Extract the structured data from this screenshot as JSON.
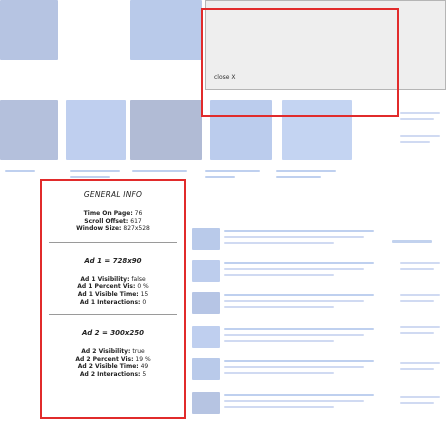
{
  "ad_popup": {
    "close_label": "close X"
  },
  "general_info": {
    "title": "GENERAL INFO",
    "time_on_page": {
      "label": "Time On Page:",
      "value": "76"
    },
    "scroll_offset": {
      "label": "Scroll Offset:",
      "value": "617"
    },
    "window_size": {
      "label": "Window Size:",
      "value": "827x528"
    }
  },
  "ads": [
    {
      "title": "Ad 1 = 728x90",
      "visibility": {
        "label": "Ad 1 Visibility:",
        "value": "false"
      },
      "percent_vis": {
        "label": "Ad 1 Percent Vis:",
        "value": "0 %"
      },
      "visible_time": {
        "label": "Ad 1 Visible Time:",
        "value": "15"
      },
      "interactions": {
        "label": "Ad 1 Interactions:",
        "value": "0"
      }
    },
    {
      "title": "Ad 2 = 300x250",
      "visibility": {
        "label": "Ad 2 Visibility:",
        "value": "true"
      },
      "percent_vis": {
        "label": "Ad 2 Percent Vis:",
        "value": "19 %"
      },
      "visible_time": {
        "label": "Ad 2 Visible Time:",
        "value": "49"
      },
      "interactions": {
        "label": "Ad 2 Interactions:",
        "value": "5"
      }
    }
  ]
}
